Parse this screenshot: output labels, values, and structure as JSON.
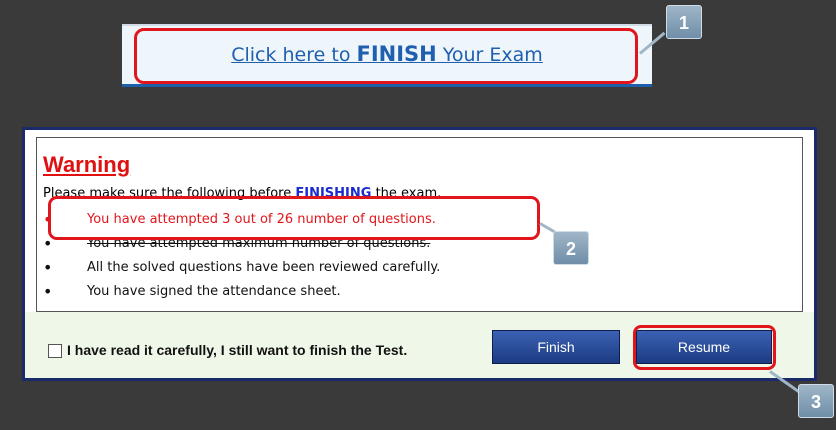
{
  "finish_link": {
    "pre": "Click here to ",
    "keyword": "FINISH",
    "post": " Your Exam"
  },
  "callouts": [
    "1",
    "2",
    "3"
  ],
  "warning": {
    "title": "Warning",
    "intro_pre": "Please make sure the following before ",
    "intro_keyword": "FINISHING",
    "intro_post": " the exam.",
    "items": [
      "You have attempted 3 out of 26 number of questions.",
      "You have attempted maximum number of questions.",
      "All the solved questions have been  reviewed carefully.",
      "You have signed the attendance sheet."
    ]
  },
  "confirm_checkbox_label": "I have read it carefully, I still want to finish the Test.",
  "buttons": {
    "finish": "Finish",
    "resume": "Resume"
  },
  "colors": {
    "highlight": "#e0161c",
    "link": "#1f5fb0",
    "button": "#1c3b83",
    "footer": "#eef7e8"
  }
}
